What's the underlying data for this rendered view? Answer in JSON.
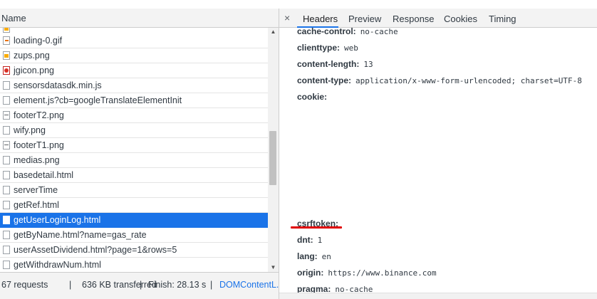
{
  "network": {
    "column_header": "Name",
    "requests": [
      {
        "name": "loading-0.gif",
        "icon": "gif-file-icon"
      },
      {
        "name": "zups.png",
        "icon": "png-file-icon"
      },
      {
        "name": "jgicon.png",
        "icon": "red-image-icon"
      },
      {
        "name": "sensorsdatasdk.min.js",
        "icon": "script-file-icon"
      },
      {
        "name": "element.js?cb=googleTranslateElementInit",
        "icon": "script-file-icon"
      },
      {
        "name": "footerT2.png",
        "icon": "dash-image-icon"
      },
      {
        "name": "wify.png",
        "icon": "blank-file-icon"
      },
      {
        "name": "footerT1.png",
        "icon": "dash-image-icon"
      },
      {
        "name": "medias.png",
        "icon": "blank-file-icon"
      },
      {
        "name": "basedetail.html",
        "icon": "document-file-icon"
      },
      {
        "name": "serverTime",
        "icon": "document-file-icon"
      },
      {
        "name": "getRef.html",
        "icon": "document-file-icon"
      },
      {
        "name": "getUserLoginLog.html",
        "icon": "document-file-icon",
        "selected": true
      },
      {
        "name": "getByName.html?name=gas_rate",
        "icon": "document-file-icon"
      },
      {
        "name": "userAssetDividend.html?page=1&rows=5",
        "icon": "document-file-icon"
      },
      {
        "name": "getWithdrawNum.html",
        "icon": "document-file-icon"
      }
    ],
    "status": {
      "requests": "67 requests",
      "transferred": "636 KB transferred",
      "finish": "Finish: 28.13 s",
      "domcontent": "DOMContentL..."
    }
  },
  "detail_panel": {
    "close_label": "×",
    "tabs": [
      "Headers",
      "Preview",
      "Response",
      "Cookies",
      "Timing"
    ],
    "active_tab": "Headers",
    "request_headers": [
      {
        "name": "cache-control:",
        "value": "no-cache"
      },
      {
        "name": "clienttype:",
        "value": "web"
      },
      {
        "name": "content-length:",
        "value": "13"
      },
      {
        "name": "content-type:",
        "value": "application/x-www-form-urlencoded; charset=UTF-8"
      },
      {
        "name": "cookie:",
        "value": ""
      },
      {
        "name": "csrftoken:",
        "value": ""
      },
      {
        "name": "dnt:",
        "value": "1"
      },
      {
        "name": "lang:",
        "value": "en"
      },
      {
        "name": "origin:",
        "value": "https://www.binance.com"
      },
      {
        "name": "pragma:",
        "value": "no-cache"
      }
    ],
    "highlight_color": "#e00000",
    "accent_color": "#1a73e8"
  }
}
